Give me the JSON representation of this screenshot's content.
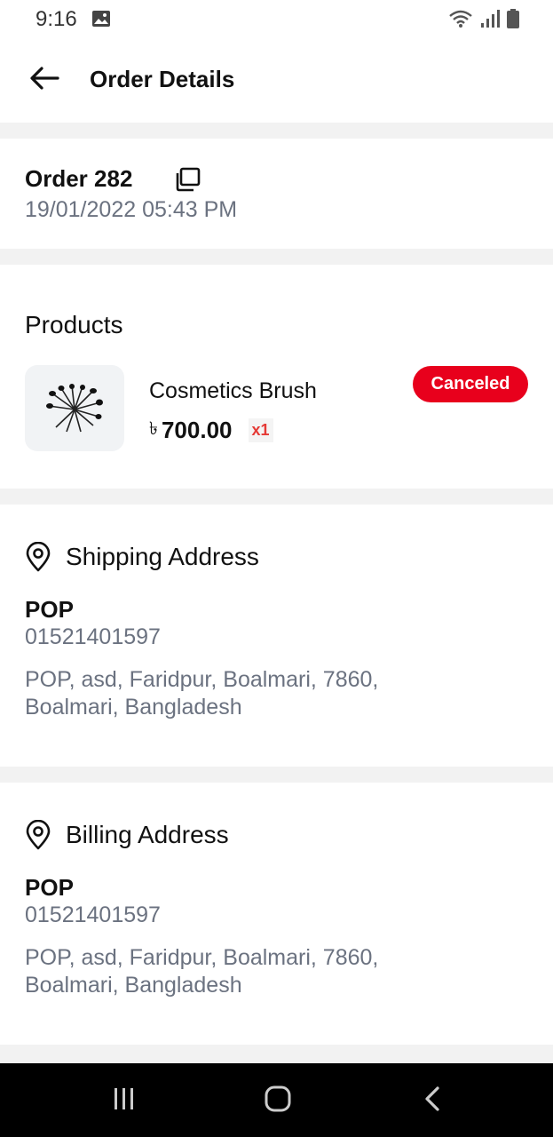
{
  "status_bar": {
    "time": "9:16",
    "icons": [
      "image-icon",
      "wifi-icon",
      "signal-icon",
      "battery-icon"
    ]
  },
  "app_bar": {
    "title": "Order Details",
    "back_icon": "arrow-left-icon"
  },
  "order": {
    "label": "Order 282",
    "date": "19/01/2022 05:43 PM",
    "copy_icon": "copy-icon"
  },
  "products": {
    "title": "Products",
    "items": [
      {
        "name": "Cosmetics Brush",
        "currency": "৳",
        "price": "700.00",
        "quantity": "x1",
        "status": "Canceled",
        "thumbnail": "cosmetics-brush-image"
      }
    ]
  },
  "shipping": {
    "title": "Shipping Address",
    "name": "POP",
    "phone": "01521401597",
    "address": "POP, asd, Faridpur, Boalmari, 7860, Boalmari, Bangladesh",
    "icon": "location-pin-icon"
  },
  "billing": {
    "title": "Billing Address",
    "name": "POP",
    "phone": "01521401597",
    "address": "POP, asd, Faridpur, Boalmari, 7860, Boalmari, Bangladesh",
    "icon": "location-pin-icon"
  },
  "nav_bar": {
    "buttons": [
      "recents-icon",
      "home-icon",
      "back-icon"
    ]
  },
  "colors": {
    "accent_red": "#e8001c",
    "text_primary": "#111111",
    "text_secondary": "#6b7280",
    "background": "#f2f2f2",
    "card": "#ffffff"
  }
}
